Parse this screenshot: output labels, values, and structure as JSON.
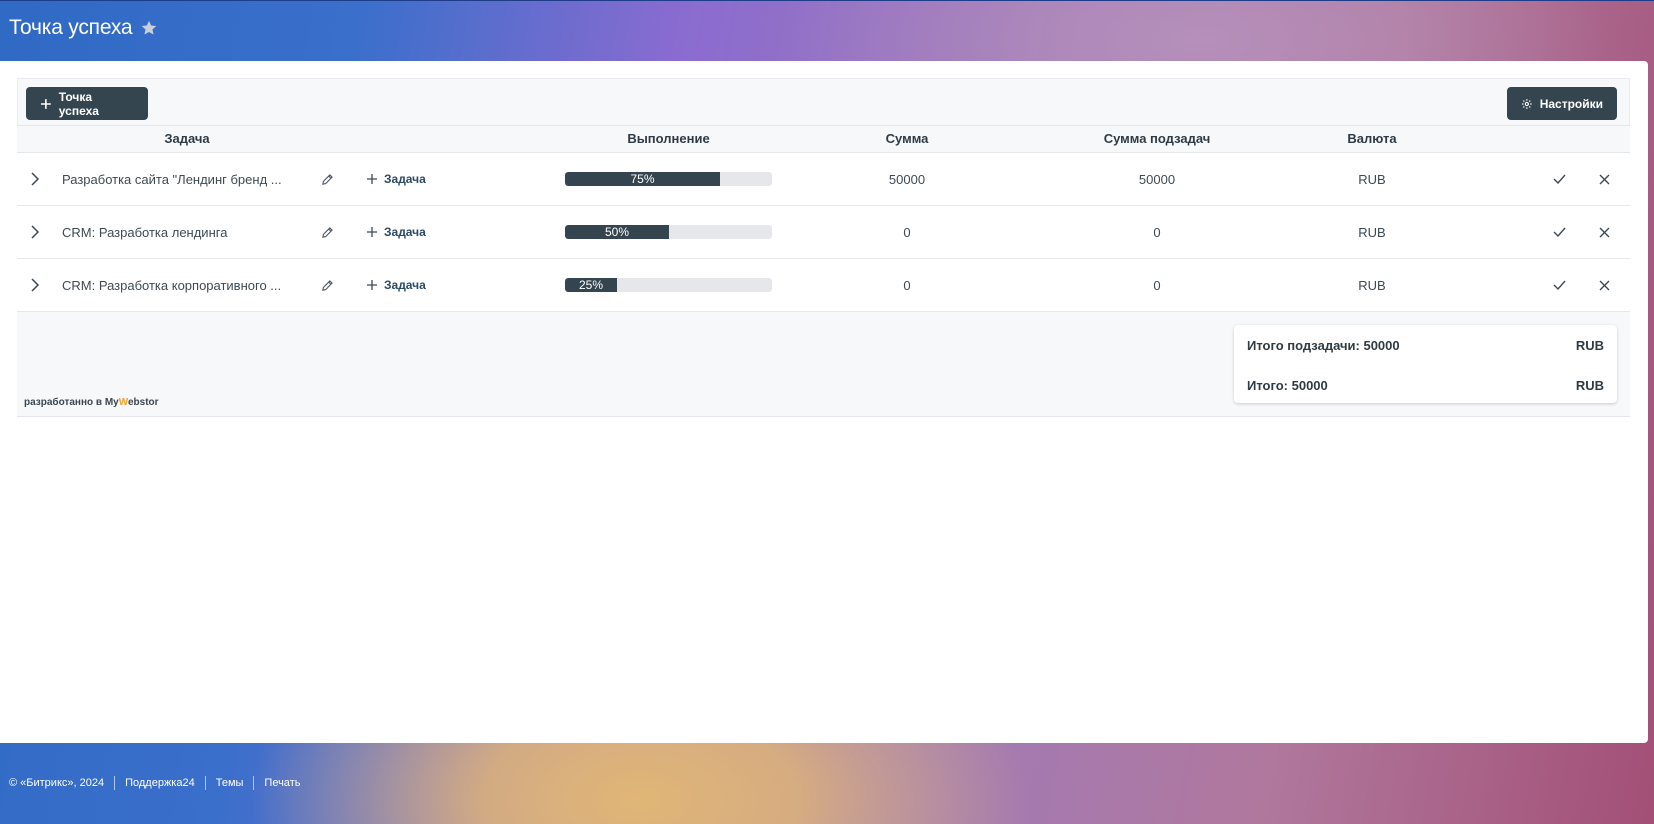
{
  "header": {
    "title": "Точка успеха"
  },
  "toolbar": {
    "add_label": "Точка успеха",
    "settings_label": "Настройки"
  },
  "table": {
    "columns": [
      "Задача",
      "Выполнение",
      "Сумма",
      "Сумма подзадач",
      "Валюта"
    ],
    "add_subtask_label": "Задача",
    "rows": [
      {
        "name": "Разработка сайта \"Лендинг бренд ...",
        "progress": 75,
        "progress_label": "75%",
        "sum": "50000",
        "subtasks_sum": "50000",
        "currency": "RUB"
      },
      {
        "name": "CRM: Разработка лендинга",
        "progress": 50,
        "progress_label": "50%",
        "sum": "0",
        "subtasks_sum": "0",
        "currency": "RUB"
      },
      {
        "name": "CRM: Разработка корпоративного ...",
        "progress": 25,
        "progress_label": "25%",
        "sum": "0",
        "subtasks_sum": "0",
        "currency": "RUB"
      }
    ]
  },
  "totals": {
    "subtasks_label": "Итого подзадачи: 50000",
    "subtasks_currency": "RUB",
    "total_label": "Итого: 50000",
    "total_currency": "RUB"
  },
  "powered": {
    "prefix": "разработанно в ",
    "my": "My",
    "w": "W",
    "rest": "ebstor"
  },
  "footer": {
    "copyright": "© «Битрикс», 2024",
    "support": "Поддержка24",
    "themes": "Темы",
    "print": "Печать"
  },
  "colors": {
    "dark": "#344550",
    "track": "#e6e7ea",
    "accent": "#f0a030"
  }
}
